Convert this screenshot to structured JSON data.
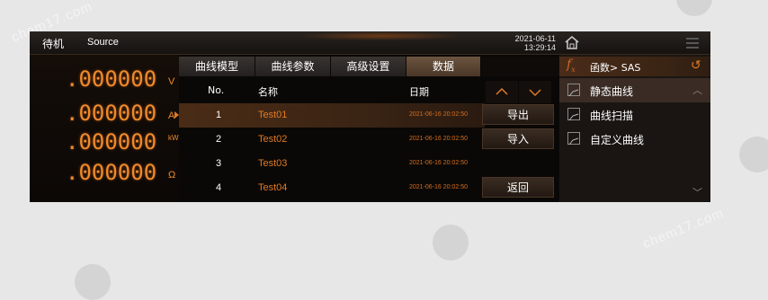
{
  "status": {
    "mode": "待机",
    "source": "Source",
    "date": "2021-06-11",
    "time": "13:29:14"
  },
  "readings": [
    {
      "value": ".000000",
      "unit": "V"
    },
    {
      "value": ".000000",
      "unit": "A"
    },
    {
      "value": ".000000",
      "unit": "kW"
    },
    {
      "value": ".000000",
      "unit": "Ω"
    }
  ],
  "tabs": [
    "曲线模型",
    "曲线参数",
    "高级设置",
    "数据"
  ],
  "active_tab": "数据",
  "table": {
    "headers": {
      "no": "No.",
      "name": "名称",
      "date": "日期"
    },
    "rows": [
      {
        "no": "1",
        "name": "Test01",
        "date": "2021-06-16 20:02:50"
      },
      {
        "no": "2",
        "name": "Test02",
        "date": "2021-06-16 20:02:50"
      },
      {
        "no": "3",
        "name": "Test03",
        "date": "2021-06-16 20:02:50"
      },
      {
        "no": "4",
        "name": "Test04",
        "date": "2021-06-16 20:02:50"
      }
    ],
    "selected_row": 1
  },
  "actions": {
    "export": "导出",
    "import": "导入",
    "back": "返回"
  },
  "function_menu": {
    "header": "函数> SAS",
    "items": [
      "静态曲线",
      "曲线扫描",
      "自定义曲线"
    ],
    "selected_item": "静态曲线"
  },
  "colors": {
    "accent": "#e07a24",
    "reading": "#f08a2a",
    "background": "#0a0806"
  }
}
